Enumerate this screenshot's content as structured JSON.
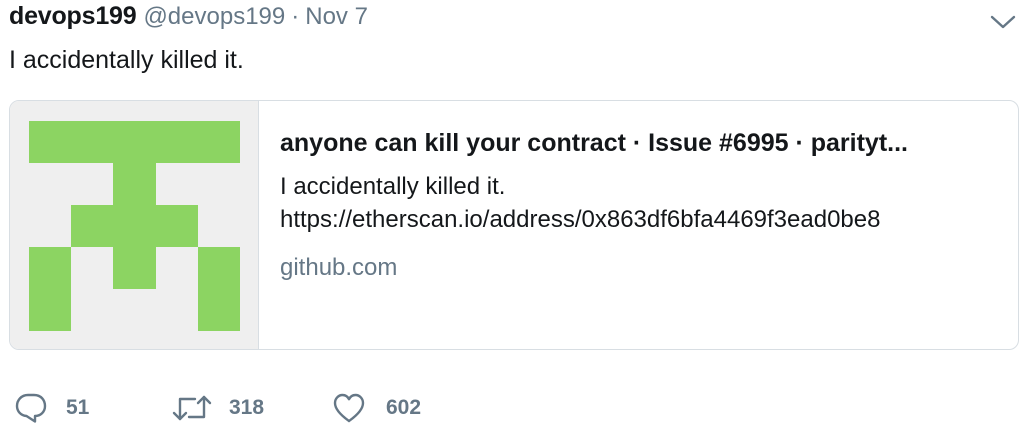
{
  "tweet": {
    "username": "devops199",
    "handle": "@devops199",
    "separator": "·",
    "date": "Nov 7",
    "text": "I accidentally killed it."
  },
  "card": {
    "title": "anyone can kill your contract · Issue #6995 · parityt...",
    "description_line1": "I accidentally killed it.",
    "description_line2": "https://etherscan.io/address/0x863df6bfa4469f3ead0be8",
    "domain": "github.com",
    "thumbnail_color": "#8cd462"
  },
  "actions": {
    "reply_count": "51",
    "retweet_count": "318",
    "like_count": "602"
  },
  "icons": [
    "chevron-down-icon",
    "reply-icon",
    "retweet-icon",
    "heart-icon"
  ],
  "colors": {
    "text": "#14171a",
    "secondary": "#657786",
    "border": "#d8dee3",
    "thumb_bg": "#efefef"
  }
}
